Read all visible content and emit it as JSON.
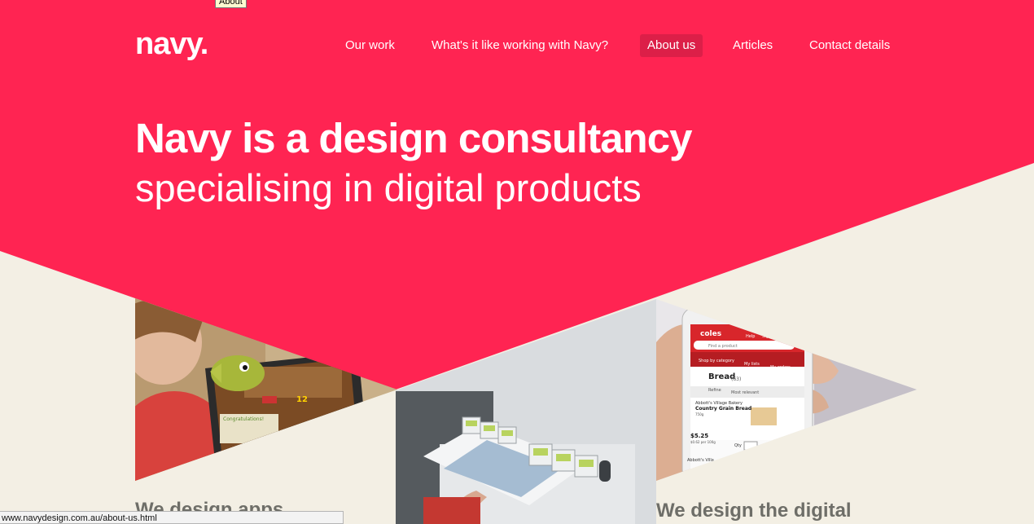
{
  "tooltip": "About",
  "brand": {
    "logo_text": "navy."
  },
  "nav": {
    "items": [
      {
        "label": "Our work"
      },
      {
        "label": "What's it like working with Navy?"
      },
      {
        "label": "About us"
      },
      {
        "label": "Articles"
      },
      {
        "label": "Contact details"
      }
    ],
    "active": "About us"
  },
  "hero": {
    "headline": "Navy is a design consultancy",
    "subheadline": "specialising in digital products"
  },
  "sections": [
    {
      "heading": "We design apps"
    },
    {
      "heading": "We design the digital"
    }
  ],
  "phone_screen": {
    "brand": "coles",
    "help": "Help",
    "signin": "Sign in",
    "search_placeholder": "Find a product",
    "tabs": [
      "Shop by category",
      "My lists",
      "My orders"
    ],
    "category": "Bread",
    "count": "(63)",
    "refine": "Refine",
    "sort": "Most relevant",
    "product_brand": "Abbott's Village Bakery",
    "product_name": "Country Grain Bread",
    "product_size": "750g",
    "price": "$5.25",
    "unit_price": "$0.62 per 100g",
    "qty_label": "Qty",
    "next_brand": "Abbott's Villa"
  },
  "game_screen": {
    "banner": "Congratulations!",
    "score": "12"
  },
  "status_url": "www.navydesign.com.au/about-us.html",
  "colors": {
    "brand_pink": "#ff2452",
    "background": "#f3efe4",
    "active_nav": "#dc1f48",
    "heading_gray": "#6e6e68"
  }
}
